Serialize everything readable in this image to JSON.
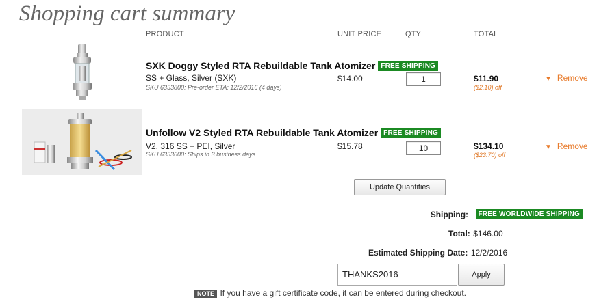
{
  "page_title": "Shopping cart summary",
  "columns": {
    "product": "PRODUCT",
    "unit_price": "UNIT PRICE",
    "qty": "QTY",
    "total": "TOTAL"
  },
  "items": [
    {
      "name": "SXK Doggy Styled RTA Rebuildable Tank Atomizer",
      "badge": "FREE SHIPPING",
      "variant": "SS + Glass, Silver (SXK)",
      "sku": "SKU 6353800: Pre-order ETA: 12/2/2016 (4 days)",
      "unit_price": "$14.00",
      "qty": "1",
      "total": "$11.90",
      "discount": "($2.10) off",
      "remove": "Remove"
    },
    {
      "name": "Unfollow V2 Styled RTA Rebuildable Tank Atomizer",
      "badge": "FREE SHIPPING",
      "variant": "V2, 316 SS + PEI, Silver",
      "sku": "SKU 6353600: Ships in 3 business days",
      "unit_price": "$15.78",
      "qty": "10",
      "total": "$134.10",
      "discount": "($23.70) off",
      "remove": "Remove"
    }
  ],
  "update_button": "Update Quantities",
  "summary": {
    "shipping_label": "Shipping:",
    "shipping_badge": "FREE WORLDWIDE SHIPPING",
    "total_label": "Total:",
    "total_value": "$146.00",
    "est_label": "Estimated Shipping Date:",
    "est_value": "12/2/2016"
  },
  "coupon": {
    "value": "THANKS2016",
    "apply_label": "Apply"
  },
  "note": {
    "tag": "NOTE",
    "text": "If you have a gift certificate code, it can be entered during checkout."
  },
  "colors": {
    "badge_green": "#1b8a23",
    "remove_orange": "#e87a2a",
    "discount_orange": "#e07a2a"
  }
}
